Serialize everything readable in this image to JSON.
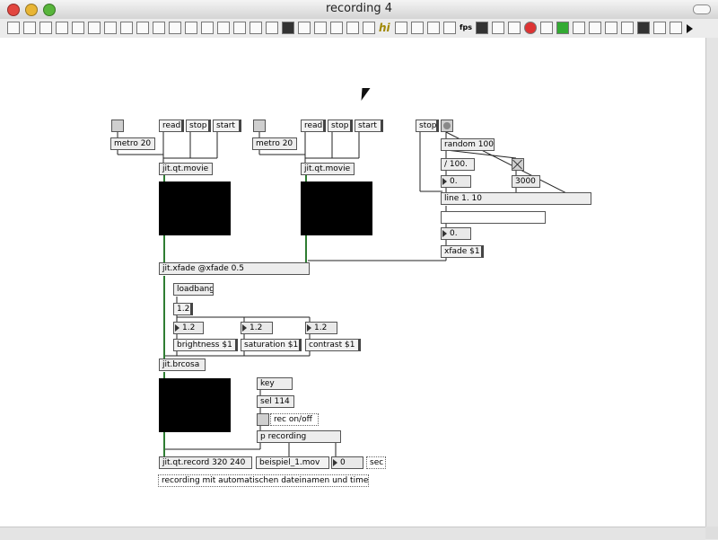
{
  "window": {
    "title": "recording 4"
  },
  "patch": {
    "left": {
      "metro": "metro 20",
      "read": "read",
      "stop": "stop",
      "start": "start",
      "movie": "jit.qt.movie"
    },
    "right": {
      "metro": "metro 20",
      "read": "read",
      "stop": "stop",
      "start": "start",
      "movie": "jit.qt.movie"
    },
    "random_ctrl": {
      "stop": "stop",
      "random": "random 100",
      "div": "/ 100.",
      "num_a": "0.",
      "ms": "3000",
      "line": "line 1. 10",
      "num_b": "0.",
      "xfade_msg": "xfade $1"
    },
    "xfade_obj": "jit.xfade @xfade 0.5",
    "loadbang": "loadbang",
    "init_value": "1.2",
    "brightness": {
      "num": "1.2",
      "msg": "brightness $1"
    },
    "saturation": {
      "num": "1.2",
      "msg": "saturation $1"
    },
    "contrast": {
      "num": "1.2",
      "msg": "contrast $1"
    },
    "brcosa": "jit.brcosa",
    "key": "key",
    "sel": "sel 114",
    "rec_label": "rec on/off",
    "p_recording": "p recording",
    "record_obj": "jit.qt.record 320 240",
    "filename": "beispiel_1.mov",
    "seconds": "0",
    "sec_label": "sec",
    "description": "recording mit automatischen dateinamen und timer"
  }
}
